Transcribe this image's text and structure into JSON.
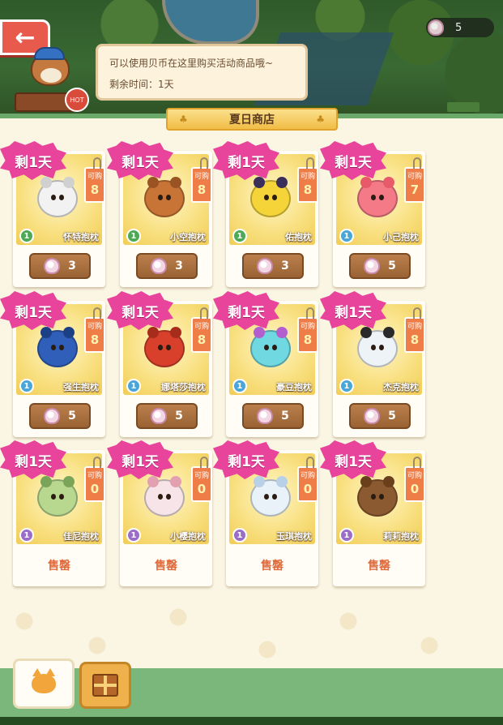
{
  "header": {
    "back_label": "←",
    "coin_count": "5",
    "speech_line1": "可以使用贝币在这里购买活动商品哦~",
    "speech_line2": "剩余时间：1天",
    "hot_label": "HOT"
  },
  "shop": {
    "title": "夏日商店",
    "buy_limit_label": "可购",
    "timer_badge": "剩1天",
    "sold_out_label": "售罄",
    "items": [
      {
        "name": "怀特抱枕",
        "remaining": "8",
        "price": "3",
        "tier": "1",
        "tier_color": "#4caa55",
        "pet_color": "#f2f2f2",
        "ear_color": "#d0d0d0",
        "sold_out": false
      },
      {
        "name": "小空抱枕",
        "remaining": "8",
        "price": "3",
        "tier": "1",
        "tier_color": "#4caa55",
        "pet_color": "#c87436",
        "ear_color": "#9a5424",
        "sold_out": false
      },
      {
        "name": "佑抱枕",
        "remaining": "8",
        "price": "3",
        "tier": "1",
        "tier_color": "#4caa55",
        "pet_color": "#f5d43a",
        "ear_color": "#3a2e5a",
        "sold_out": false
      },
      {
        "name": "小己抱枕",
        "remaining": "7",
        "price": "5",
        "tier": "1",
        "tier_color": "#4aa6d8",
        "pet_color": "#f57a88",
        "ear_color": "#e65a6a",
        "sold_out": false
      },
      {
        "name": "强生抱枕",
        "remaining": "8",
        "price": "5",
        "tier": "1",
        "tier_color": "#4aa6d8",
        "pet_color": "#2f5fb8",
        "ear_color": "#1d3f85",
        "sold_out": false
      },
      {
        "name": "娜塔莎抱枕",
        "remaining": "8",
        "price": "5",
        "tier": "1",
        "tier_color": "#4aa6d8",
        "pet_color": "#d8402c",
        "ear_color": "#a82c1c",
        "sold_out": false
      },
      {
        "name": "豪豆抱枕",
        "remaining": "8",
        "price": "5",
        "tier": "1",
        "tier_color": "#4aa6d8",
        "pet_color": "#6fd8e0",
        "ear_color": "#b45fd0",
        "sold_out": false
      },
      {
        "name": "杰克抱枕",
        "remaining": "8",
        "price": "5",
        "tier": "1",
        "tier_color": "#4aa6d8",
        "pet_color": "#eef3f8",
        "ear_color": "#2a2a2a",
        "sold_out": false
      },
      {
        "name": "佳尼抱枕",
        "remaining": "0",
        "price": "",
        "tier": "1",
        "tier_color": "#9a6ec8",
        "pet_color": "#b8d890",
        "ear_color": "#7aa458",
        "sold_out": true
      },
      {
        "name": "小樱抱枕",
        "remaining": "0",
        "price": "",
        "tier": "1",
        "tier_color": "#9a6ec8",
        "pet_color": "#f6e4e8",
        "ear_color": "#e3a0b0",
        "sold_out": true
      },
      {
        "name": "玉琪抱枕",
        "remaining": "0",
        "price": "",
        "tier": "1",
        "tier_color": "#9a6ec8",
        "pet_color": "#e8f2f8",
        "ear_color": "#b8d0e8",
        "sold_out": true
      },
      {
        "name": "莉莉抱枕",
        "remaining": "0",
        "price": "",
        "tier": "1",
        "tier_color": "#9a6ec8",
        "pet_color": "#8c5a30",
        "ear_color": "#6a401c",
        "sold_out": true
      }
    ]
  },
  "tabs": [
    {
      "icon": "cat-icon",
      "active": true
    },
    {
      "icon": "gift-icon",
      "active": false
    }
  ],
  "colors": {
    "accent_pink": "#e9449b",
    "tag_orange": "#ee7d47",
    "sold_out_text": "#e06a3b",
    "shop_bg": "#fbf6e4"
  }
}
